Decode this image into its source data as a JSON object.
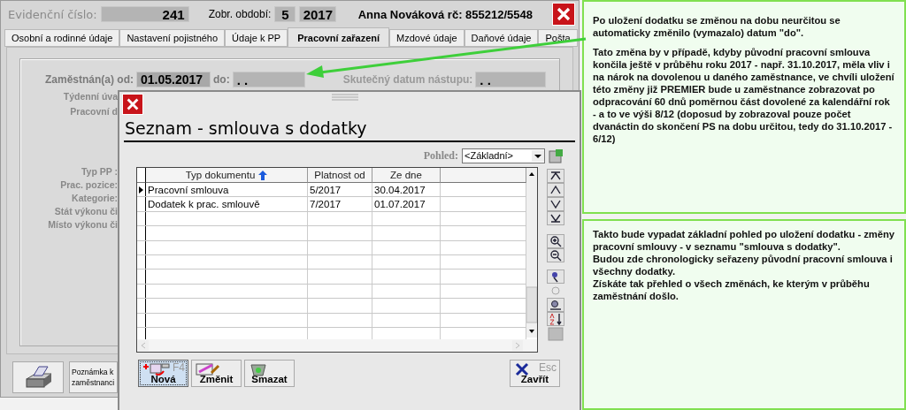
{
  "main_window": {
    "header": {
      "evidence_label": "Evidenční číslo:",
      "evidence_value": "241",
      "period_label": "Zobr. období:",
      "period_month": "5",
      "period_year": "2017",
      "employee": "Anna Nováková rč: 855212/5548"
    },
    "tabs": [
      {
        "label": "Osobní a rodinné údaje",
        "selected": false
      },
      {
        "label": "Nastavení pojistného",
        "selected": false
      },
      {
        "label": "Údaje k PP",
        "selected": false
      },
      {
        "label": "Pracovní zařazení",
        "selected": true
      },
      {
        "label": "Mzdové údaje",
        "selected": false
      },
      {
        "label": "Daňové údaje",
        "selected": false
      },
      {
        "label": "Pošta",
        "selected": false
      }
    ],
    "employment": {
      "from_label": "Zaměstnán(a) od:",
      "from_value": "01.05.2017",
      "to_label": "do:",
      "to_value": ". .",
      "start_label": "Skutečný datum nástupu:",
      "start_value": ". ."
    },
    "upper_labels": [
      "Týdenní úva",
      "Pracovní d"
    ],
    "lower_labels": [
      "Typ PP :",
      "Prac. pozice:",
      "Kategorie:",
      "Stát výkonu či",
      "Místo výkonu či"
    ],
    "note_button": {
      "lines": [
        "Poznámka k",
        "zaměstnanci"
      ]
    }
  },
  "dialog": {
    "title": "Seznam - smlouva s dodatky",
    "view_label": "Pohled:",
    "view_value": "<Základní>",
    "columns": [
      {
        "label": "Typ dokumentu",
        "sorted": true
      },
      {
        "label": "Platnost od",
        "sorted": false
      },
      {
        "label": "Ze dne",
        "sorted": false
      }
    ],
    "rows": [
      {
        "cells": [
          "Pracovní smlouva",
          "5/2017",
          "30.04.2017"
        ],
        "selected": true
      },
      {
        "cells": [
          "Dodatek k prac. smlouvě",
          "7/2017",
          "01.07.2017"
        ],
        "selected": false
      }
    ],
    "buttons": [
      {
        "kind": "new",
        "label": "Nová",
        "key": "F4",
        "selected": true
      },
      {
        "kind": "edit",
        "label": "Změnit",
        "selected": false
      },
      {
        "kind": "delete",
        "label": "Smazat",
        "selected": false
      },
      {
        "kind": "close",
        "label": "Zavřít",
        "key": "Esc",
        "selected": false
      }
    ]
  },
  "notes": [
    {
      "kind": "spaced",
      "paragraphs": [
        "Po uložení dodatku se změnou na dobu neurčitou se automaticky změnilo (vymazalo) datum \"do\".",
        "Tato změna by v případě, kdyby původní pracovní smlouva končila ještě v průběhu roku 2017 - např. 31.10.2017, měla vliv i na nárok na dovolenou u daného zaměstnance, ve chvíli uložení této změny již PREMIER bude u zaměstnance zobrazovat po odpracování 60 dnů poměrnou část dovolené za kalendářní rok - a to ve výši 8/12 (doposud by zobrazoval pouze počet dvanáctin do skončení PS na dobu určitou, tedy do 31.10.2017 - 6/12)"
      ]
    },
    {
      "kind": "tight",
      "paragraphs": [
        "Takto bude vypadat základní pohled po uložení dodatku - změny pracovní smlouvy - v seznamu \"smlouva s dodatky\".",
        "Budou  zde chronologicky seřazeny původní pracovní smlouva i všechny dodatky.",
        "Získáte tak přehled o všech změnách, ke kterým v průběhu zaměstnání došlo."
      ]
    }
  ]
}
